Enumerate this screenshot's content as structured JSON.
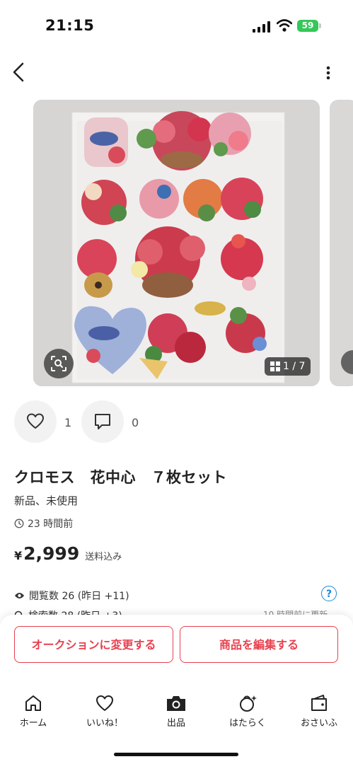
{
  "status_bar": {
    "time": "21:15",
    "battery": "59"
  },
  "gallery": {
    "counter": "1 / 7"
  },
  "actions": {
    "likes": "1",
    "comments": "0"
  },
  "item": {
    "title": "クロモス　花中心　７枚セット",
    "condition": "新品、未使用",
    "posted": "23 時間前",
    "price_symbol": "¥",
    "price": "2,999",
    "shipping": "送料込み"
  },
  "stats": {
    "views": "閲覧数  26 (昨日 +11)",
    "searches": "検索数  28 (昨日 +3)",
    "updated": "10 時間前に更新",
    "help": "?"
  },
  "buttons": {
    "auction": "オークションに変更する",
    "edit": "商品を編集する"
  },
  "tabs": [
    {
      "label": "ホーム",
      "icon": "home-icon"
    },
    {
      "label": "いいね！",
      "icon": "heart-icon"
    },
    {
      "label": "出品",
      "icon": "camera-icon"
    },
    {
      "label": "はたらく",
      "icon": "work-icon"
    },
    {
      "label": "おさいふ",
      "icon": "wallet-icon"
    }
  ],
  "colors": {
    "accent": "#e8414f",
    "help_blue": "#1b88d8",
    "battery_green": "#35c759"
  }
}
